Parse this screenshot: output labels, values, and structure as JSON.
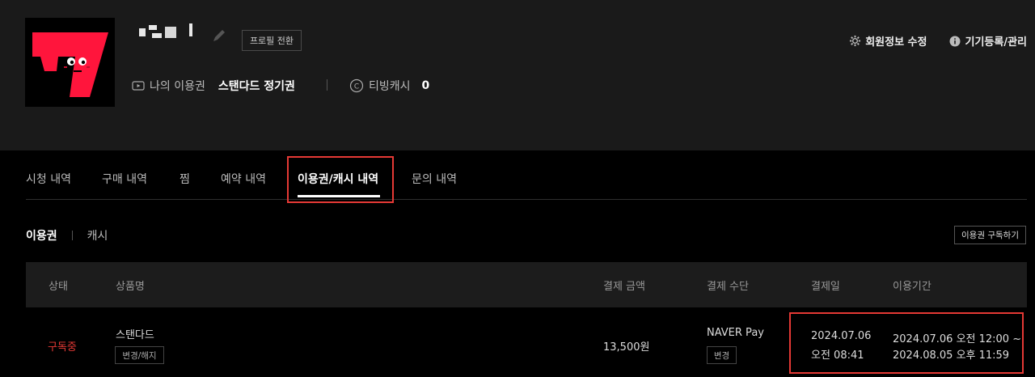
{
  "profile": {
    "switch_label": "프로필 전환",
    "my_pass_label": "나의 이용권",
    "my_pass_value": "스탠다드 정기권",
    "cash_label": "티빙캐시",
    "cash_value": "0"
  },
  "top_links": {
    "edit_info": "회원정보 수정",
    "device_manage": "기기등록/관리"
  },
  "tabs": [
    {
      "label": "시청 내역"
    },
    {
      "label": "구매 내역"
    },
    {
      "label": "찜"
    },
    {
      "label": "예약 내역"
    },
    {
      "label": "이용권/캐시 내역"
    },
    {
      "label": "문의 내역"
    }
  ],
  "active_tab": "이용권/캐시 내역",
  "subtabs": {
    "active": "이용권",
    "other": "캐시"
  },
  "subscribe_button": "이용권 구독하기",
  "table": {
    "headers": [
      "상태",
      "상품명",
      "결제 금액",
      "결제 수단",
      "결제일",
      "이용기간"
    ],
    "rows": [
      {
        "status": "구독중",
        "product": "스탠다드",
        "product_action": "변경/해지",
        "amount": "13,500원",
        "method": "NAVER Pay",
        "method_action": "변경",
        "pay_date_line1": "2024.07.06",
        "pay_date_line2": "오전 08:41",
        "period_line1": "2024.07.06 오전 12:00 ~",
        "period_line2": "2024.08.05 오후 11:59"
      }
    ]
  },
  "colors": {
    "accent_red": "#e53935",
    "logo_red": "#ff153c",
    "header_bg": "#1a1a1a"
  }
}
